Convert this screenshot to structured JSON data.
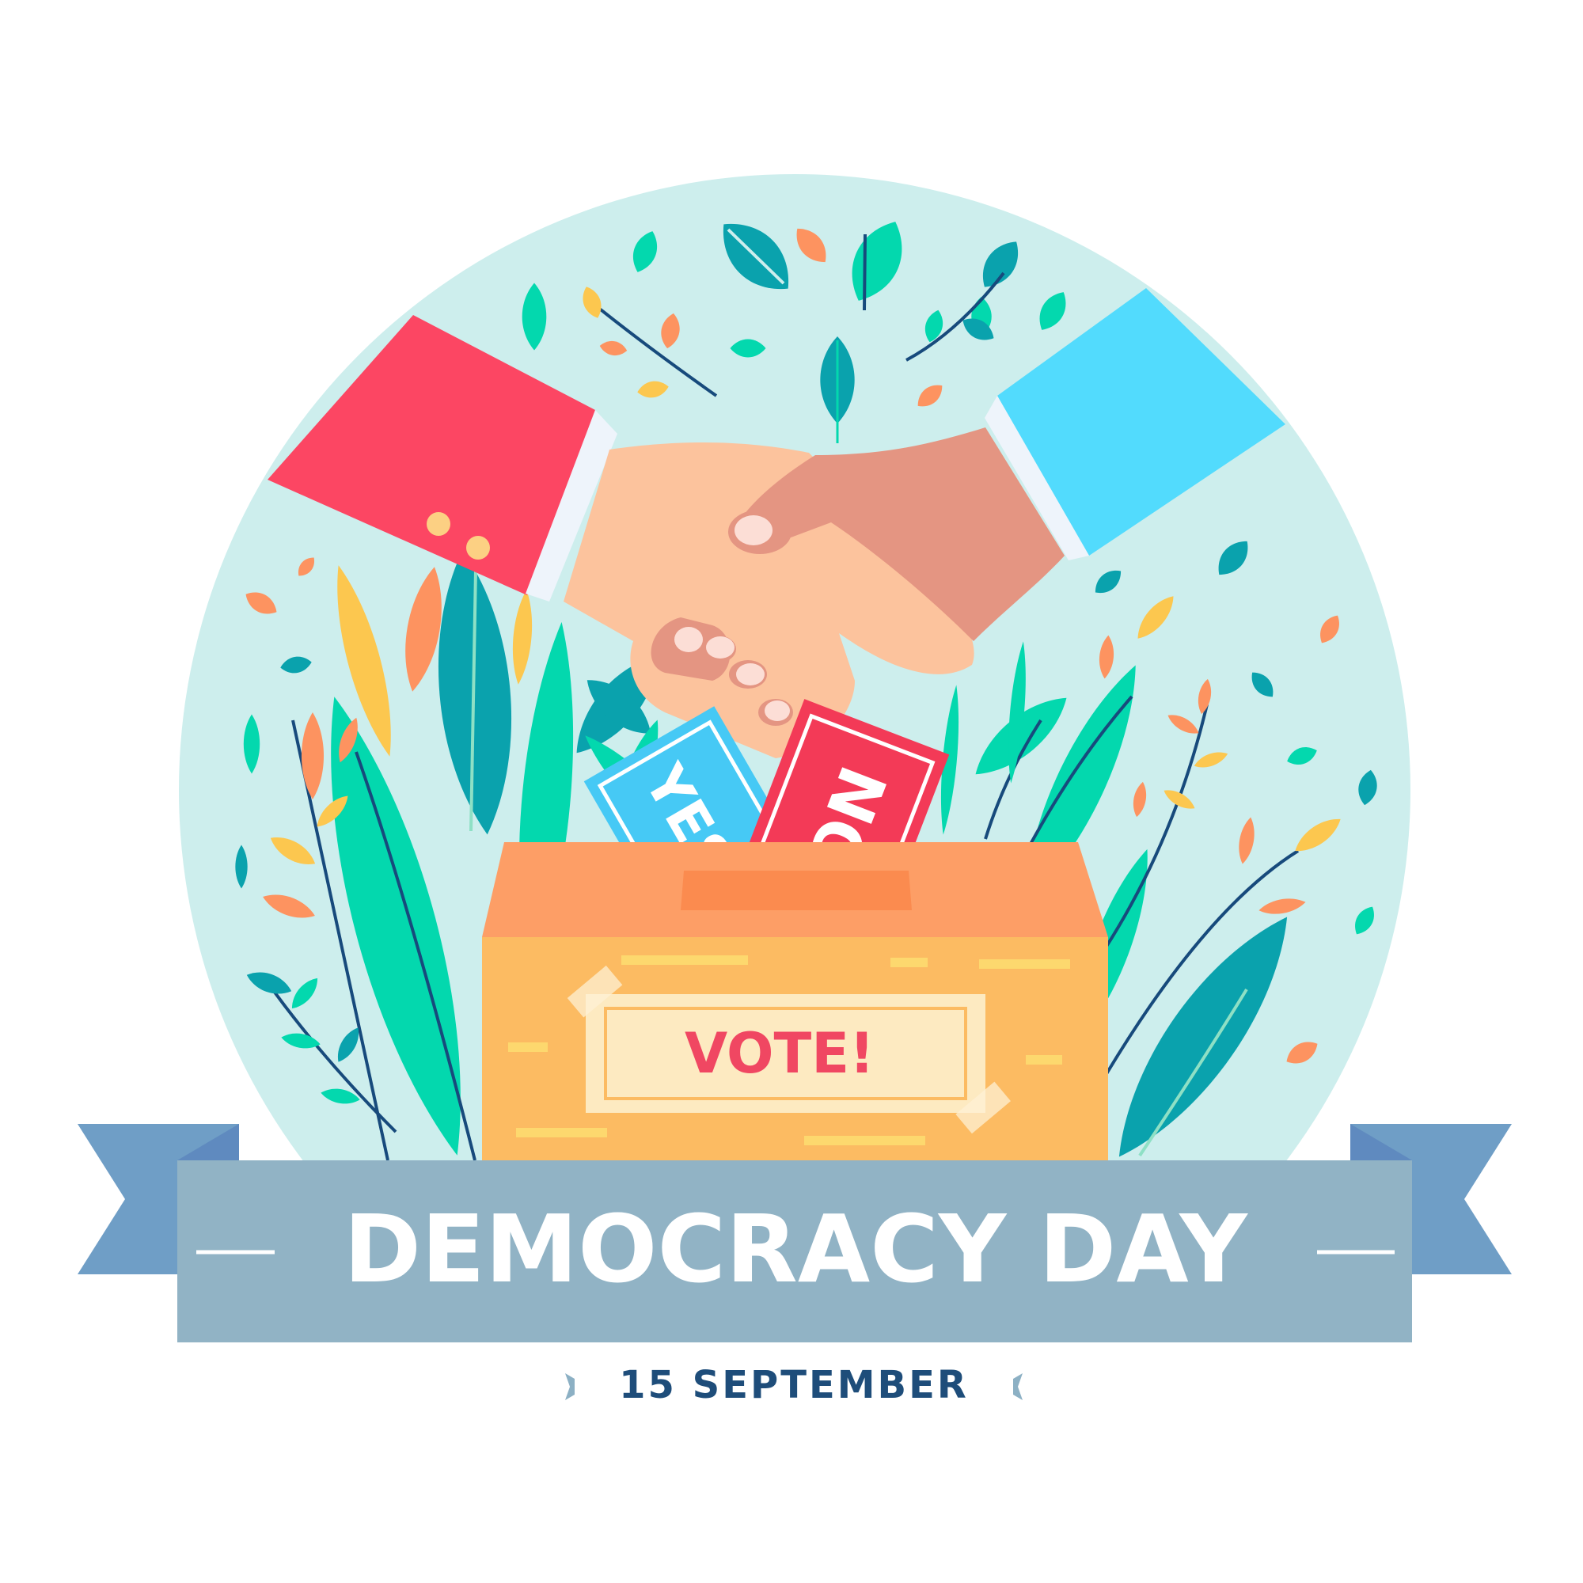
{
  "colors": {
    "background": "#ffffff",
    "circle": "#cdeeed",
    "sleeve_left": "#fc4663",
    "sleeve_right": "#52dbfd",
    "cuff": "#eef4fb",
    "hand_light": "#fcc39d",
    "hand_dark": "#e49582",
    "nail": "#fcded6",
    "leaf_teal": "#0aa2ad",
    "leaf_green": "#03d8ae",
    "leaf_orange": "#fd9360",
    "leaf_yellow": "#fcc74f",
    "stem": "#174a7c",
    "box_front": "#fcbb62",
    "box_lid": "#fd9e66",
    "label_bg": "#fdeac1",
    "vote_red": "#f04762",
    "ballot_yes": "#46c9f5",
    "ballot_no": "#f33a57",
    "ribbon_main": "#91b3c5",
    "ribbon_tail": "#6f9ec6",
    "ribbon_fold": "#5f8abf",
    "title_text": "#ffffff",
    "date_text": "#1e4d7a"
  },
  "icons": {
    "handshake": "handshake-icon",
    "ballot_box": "ballot-box-icon",
    "ballot_yes": "ballot-yes-icon",
    "ballot_no": "ballot-no-icon",
    "leaves": "leaf-icon"
  },
  "ballots": {
    "yes_label": "YES",
    "no_label": "NO"
  },
  "ballot_box": {
    "label": "VOTE!"
  },
  "banner": {
    "title": "DEMOCRACY DAY"
  },
  "footer": {
    "date": "15 SEPTEMBER"
  }
}
